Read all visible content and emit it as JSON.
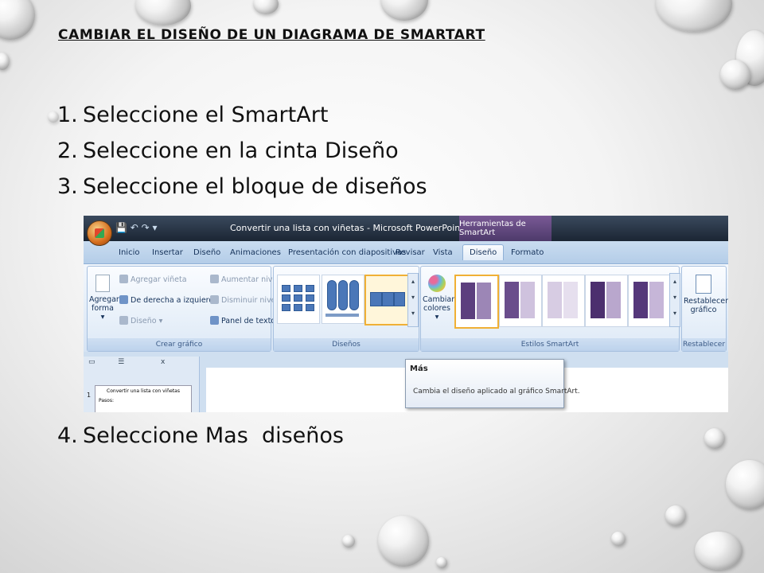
{
  "title": "CAMBIAR EL DISEÑO DE UN DIAGRAMA DE SMARTART",
  "steps": [
    {
      "num": "1.",
      "text": "Seleccione el SmartArt"
    },
    {
      "num": "2.",
      "text": "Seleccione en la cinta Diseño"
    },
    {
      "num": "3.",
      "text": "Seleccione el bloque de diseños"
    }
  ],
  "step4": {
    "num": "4.",
    "text": "Seleccione Mas  diseños"
  },
  "screenshot": {
    "window_title": "Convertir una lista con viñetas - Microsoft PowerPoint",
    "context_tab": "Herramientas de SmartArt",
    "tabs": [
      "Inicio",
      "Insertar",
      "Diseño",
      "Animaciones",
      "Presentación con diapositivas",
      "Revisar",
      "Vista",
      "Diseño",
      "Formato"
    ],
    "crear_grafico": {
      "agregar": "Agregar",
      "forma": "forma",
      "agregar_vineta": "Agregar viñeta",
      "derecha_izquierda": "De derecha a izquierda",
      "diseno": "Diseño",
      "aumentar": "Aumentar nivel",
      "disminuir": "Disminuir nivel",
      "panel": "Panel de texto",
      "group": "Crear gráfico"
    },
    "disenos_group": "Diseños",
    "estilos": {
      "cambiar": "Cambiar",
      "colores": "colores",
      "group": "Estilos SmartArt"
    },
    "restablecer": {
      "line1": "Restablecer",
      "line2": "gráfico",
      "group": "Restablecer"
    },
    "thumbnail_title": "Convertir una lista con viñetas",
    "thumbnail_sub": "Pasos:",
    "tooltip": {
      "title": "Más",
      "text": "Cambia el diseño aplicado al gráfico SmartArt."
    }
  },
  "colors": {
    "accent_purple": "#5c3f7e",
    "ribbon_blue": "#c9dcf0",
    "highlight": "#f0b035"
  }
}
